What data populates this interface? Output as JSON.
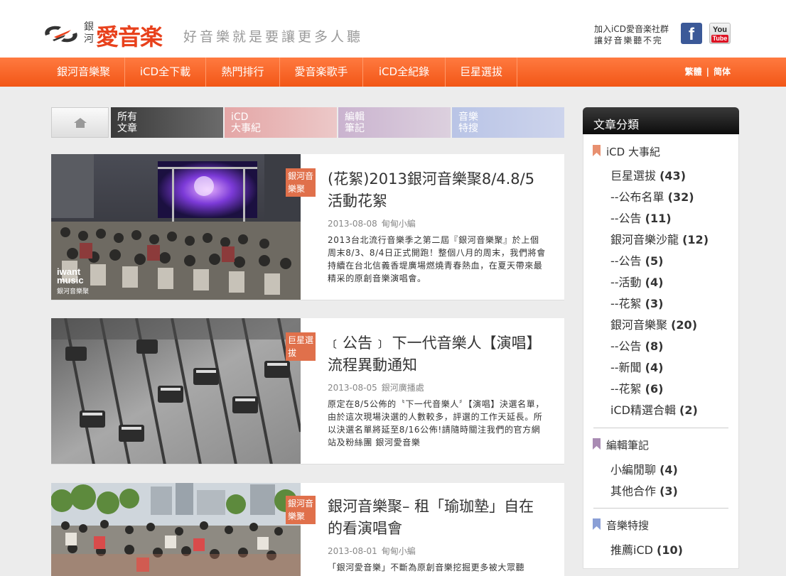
{
  "header": {
    "logo_sub": "銀河",
    "logo_text": "愛音楽",
    "slogan": "好音樂就是要讓更多人聽",
    "join_line1": "加入iCD愛音楽社群",
    "join_line2": "讓好音樂聽不完",
    "facebook_label": "f",
    "youtube_label_top": "You",
    "youtube_label_bottom": "Tube"
  },
  "nav": {
    "items": [
      "銀河音樂聚",
      "iCD全下載",
      "熱門排行",
      "愛音楽歌手",
      "iCD全紀錄",
      "巨星選拔"
    ],
    "lang_trad": "繁體",
    "lang_sep": "|",
    "lang_simp": "简体"
  },
  "tabs": [
    {
      "line1": "所有",
      "line2": "文章",
      "color": "#555555"
    },
    {
      "line1": "iCD",
      "line2": "大事紀",
      "color": "#e6b8b8"
    },
    {
      "line1": "編輯",
      "line2": "筆記",
      "color": "#d3c3d6"
    },
    {
      "line1": "音樂",
      "line2": "特搜",
      "color": "#c4cde6"
    }
  ],
  "articles": [
    {
      "badge": "銀河音樂聚",
      "title": "(花絮)2013銀河音樂聚8/4.8/5活動花絮",
      "date": "2013-08-08",
      "author": "甸甸小編",
      "excerpt": "2013台北流行音樂季之第二屆『銀河音樂聚』於上個周末8/3、8/4日正式開跑！整個八月的周末，我們將會持續在台北信義香堤廣場燃燒青春熱血，在夏天帶來最精采的原創音樂演唱會。",
      "watermark": "iwant music",
      "watermark_sub": "銀河音樂聚"
    },
    {
      "badge": "巨星選拔",
      "title": "﹝公告﹞ 下一代音樂人【演唱】流程異動通知",
      "date": "2013-08-05",
      "author": "銀河廣播處",
      "excerpt": "原定在8/5公佈的〝下一代音樂人〞【演唱】決選名單，由於這次現場決選的人數較多，評選的工作天延長。所以決選名單將延至8/16公佈!請隨時關注我們的官方網站及粉絲團 銀河愛音樂"
    },
    {
      "badge": "銀河音樂聚",
      "title": "銀河音樂聚– 租「瑜珈墊」自在的看演唱會",
      "date": "2013-08-01",
      "author": "甸甸小編",
      "excerpt": "「銀河愛音樂」不斷為原創音樂挖掘更多被大眾聽"
    }
  ],
  "sidebar": {
    "title": "文章分類",
    "groups": [
      {
        "name": "iCD 大事紀",
        "color": "#e89070",
        "items": [
          {
            "label": "巨星選拔",
            "count": "(43)"
          },
          {
            "label": "--公布名單",
            "count": "(32)"
          },
          {
            "label": "--公告",
            "count": "(11)"
          },
          {
            "label": "銀河音樂沙龍",
            "count": "(12)"
          },
          {
            "label": "--公告",
            "count": "(5)"
          },
          {
            "label": "--活動",
            "count": "(4)"
          },
          {
            "label": "--花絮",
            "count": "(3)"
          },
          {
            "label": "銀河音樂聚",
            "count": "(20)"
          },
          {
            "label": "--公告",
            "count": "(8)"
          },
          {
            "label": "--新聞",
            "count": "(4)"
          },
          {
            "label": "--花絮",
            "count": "(6)"
          },
          {
            "label": "iCD精選合輯",
            "count": "(2)"
          }
        ]
      },
      {
        "name": "編輯筆記",
        "color": "#a98bb3",
        "items": [
          {
            "label": "小編閒聊",
            "count": "(4)"
          },
          {
            "label": "其他合作",
            "count": "(3)"
          }
        ]
      },
      {
        "name": "音樂特搜",
        "color": "#8a9fd6",
        "items": [
          {
            "label": "推薦iCD",
            "count": "(10)"
          }
        ]
      }
    ]
  }
}
